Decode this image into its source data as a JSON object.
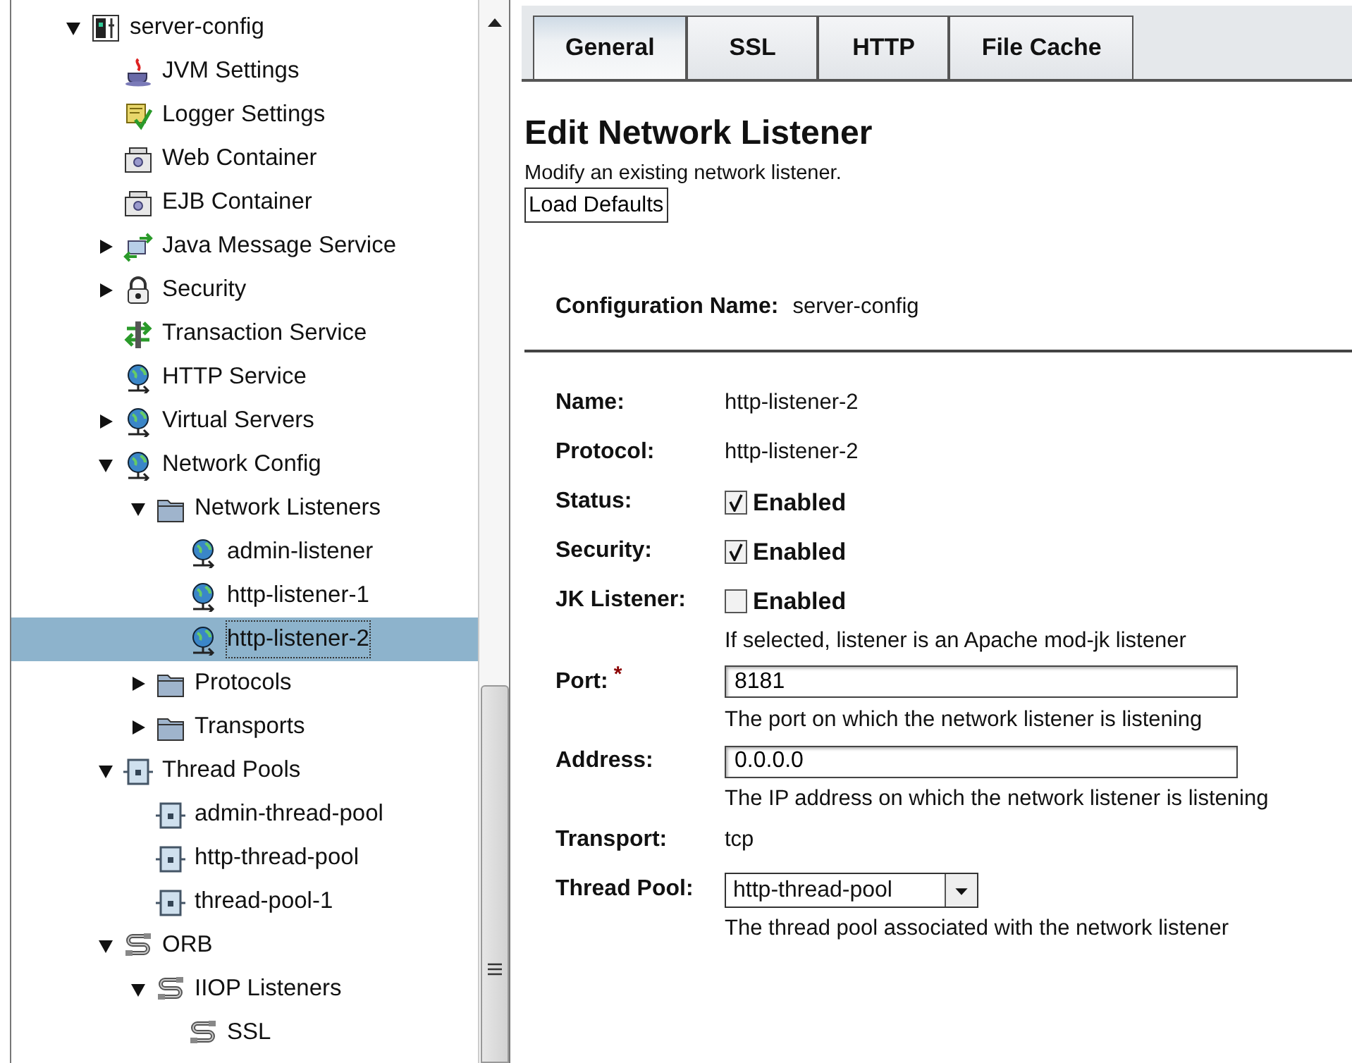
{
  "tree": {
    "items": [
      {
        "label": "server-config",
        "kind": "config",
        "expanded": true,
        "selected": false,
        "children": [
          {
            "label": "JVM Settings",
            "kind": "java",
            "selected": false
          },
          {
            "label": "Logger Settings",
            "kind": "logger",
            "selected": false
          },
          {
            "label": "Web Container",
            "kind": "container",
            "selected": false
          },
          {
            "label": "EJB Container",
            "kind": "container",
            "selected": false
          },
          {
            "label": "Java Message Service",
            "kind": "messaging",
            "expanded": false,
            "selected": false
          },
          {
            "label": "Security",
            "kind": "security",
            "expanded": false,
            "selected": false
          },
          {
            "label": "Transaction Service",
            "kind": "transaction",
            "selected": false
          },
          {
            "label": "HTTP Service",
            "kind": "globe",
            "selected": false
          },
          {
            "label": "Virtual Servers",
            "kind": "globe",
            "expanded": false,
            "selected": false
          },
          {
            "label": "Network Config",
            "kind": "globe",
            "expanded": true,
            "selected": false,
            "children": [
              {
                "label": "Network Listeners",
                "kind": "folder",
                "expanded": true,
                "selected": false,
                "children": [
                  {
                    "label": "admin-listener",
                    "kind": "globe",
                    "selected": false
                  },
                  {
                    "label": "http-listener-1",
                    "kind": "globe",
                    "selected": false
                  },
                  {
                    "label": "http-listener-2",
                    "kind": "globe",
                    "selected": true
                  }
                ]
              },
              {
                "label": "Protocols",
                "kind": "folder",
                "expanded": false,
                "selected": false
              },
              {
                "label": "Transports",
                "kind": "folder",
                "expanded": false,
                "selected": false
              }
            ]
          },
          {
            "label": "Thread Pools",
            "kind": "pool",
            "expanded": true,
            "selected": false,
            "children": [
              {
                "label": "admin-thread-pool",
                "kind": "pool",
                "selected": false
              },
              {
                "label": "http-thread-pool",
                "kind": "pool",
                "selected": false
              },
              {
                "label": "thread-pool-1",
                "kind": "pool",
                "selected": false
              }
            ]
          },
          {
            "label": "ORB",
            "kind": "orb",
            "expanded": true,
            "selected": false,
            "children": [
              {
                "label": "IIOP Listeners",
                "kind": "orb",
                "expanded": true,
                "selected": false,
                "children": [
                  {
                    "label": "SSL",
                    "kind": "orb",
                    "selected": false
                  }
                ]
              }
            ]
          }
        ]
      }
    ]
  },
  "tabs": [
    {
      "label": "General",
      "selected": true
    },
    {
      "label": "SSL",
      "selected": false
    },
    {
      "label": "HTTP",
      "selected": false
    },
    {
      "label": "File Cache",
      "selected": false
    }
  ],
  "page": {
    "title": "Edit Network Listener",
    "description": "Modify an existing network listener.",
    "load_defaults_button": "Load Defaults",
    "configuration": {
      "label": "Configuration Name:",
      "value": "server-config"
    },
    "fields": [
      {
        "kind": "text",
        "label": "Name:",
        "value": "http-listener-2"
      },
      {
        "kind": "text",
        "label": "Protocol:",
        "value": "http-listener-2"
      },
      {
        "kind": "checkbox",
        "label": "Status:",
        "option": "Enabled",
        "checked": true
      },
      {
        "kind": "checkbox",
        "label": "Security:",
        "option": "Enabled",
        "checked": true
      },
      {
        "kind": "checkbox",
        "label": "JK Listener:",
        "option": "Enabled",
        "checked": false,
        "help": "If selected, listener is an Apache mod-jk listener"
      },
      {
        "kind": "input",
        "label": "Port:",
        "required_mark": "*",
        "value": "8181",
        "help": "The port on which the network listener is listening"
      },
      {
        "kind": "input",
        "label": "Address:",
        "value": "0.0.0.0",
        "help": "The IP address on which the network listener is listening"
      },
      {
        "kind": "text",
        "label": "Transport:",
        "value": "tcp"
      },
      {
        "kind": "select",
        "label": "Thread Pool:",
        "value": "http-thread-pool",
        "help": "The thread pool associated with the network listener"
      }
    ]
  }
}
